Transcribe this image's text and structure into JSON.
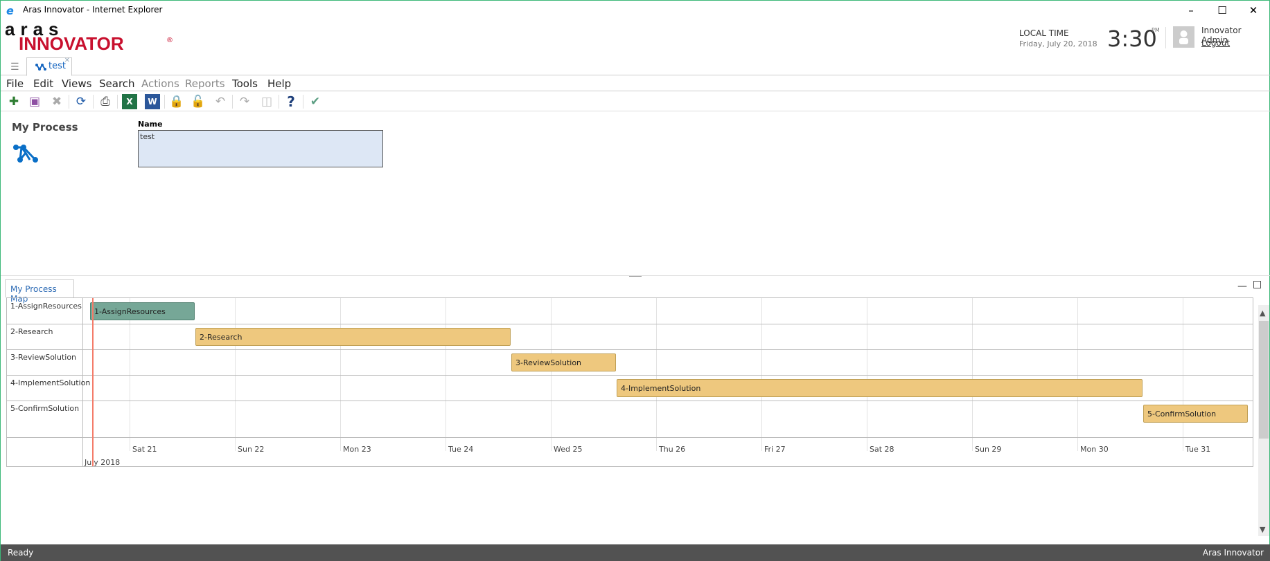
{
  "window": {
    "title": "Aras Innovator - Internet Explorer",
    "icon": "internet-explorer-icon"
  },
  "logo": {
    "line1": "aras",
    "line2": "INNOVATOR",
    "reg": "®"
  },
  "header": {
    "local_time_label": "LOCAL TIME",
    "date": "Friday, July 20, 2018",
    "time": "3:30",
    "ampm": "PM",
    "user": "Innovator Admin",
    "logout": "Logout"
  },
  "tabs": [
    {
      "label": "test",
      "icon": "process-icon"
    }
  ],
  "menu": [
    {
      "label": "File",
      "enabled": true
    },
    {
      "label": "Edit",
      "enabled": true
    },
    {
      "label": "Views",
      "enabled": true
    },
    {
      "label": "Search",
      "enabled": true
    },
    {
      "label": "Actions",
      "enabled": false
    },
    {
      "label": "Reports",
      "enabled": false
    },
    {
      "label": "Tools",
      "enabled": true
    },
    {
      "label": "Help",
      "enabled": true
    }
  ],
  "toolbar": [
    "new-icon",
    "save-icon",
    "discard-icon",
    "refresh-icon",
    "print-icon",
    "excel-icon",
    "word-icon",
    "lock-icon",
    "unlock-icon",
    "undo-icon",
    "promote-icon",
    "paste-icon",
    "help-icon",
    "done-icon"
  ],
  "form": {
    "title": "My Process",
    "name_label": "Name",
    "name_value": "test"
  },
  "panel": {
    "tab": "My Process Map"
  },
  "gantt": {
    "month_label": "July 2018",
    "current_time": "2018-07-20T15:30",
    "days": [
      "Sat 21",
      "Sun 22",
      "Mon 23",
      "Tue 24",
      "Wed 25",
      "Thu 26",
      "Fri 27",
      "Sat 28",
      "Sun 29",
      "Mon 30",
      "Tue 31"
    ],
    "tasks": [
      {
        "name": "1-AssignResources",
        "start": "2018-07-20T15:00",
        "end": "2018-07-21T15:00",
        "color": "#76a797"
      },
      {
        "name": "2-Research",
        "start": "2018-07-21T15:00",
        "end": "2018-07-24T15:00",
        "color": "#eec87e"
      },
      {
        "name": "3-ReviewSolution",
        "start": "2018-07-24T15:00",
        "end": "2018-07-25T15:00",
        "color": "#eec87e"
      },
      {
        "name": "4-ImplementSolution",
        "start": "2018-07-25T15:00",
        "end": "2018-07-30T15:00",
        "color": "#eec87e"
      },
      {
        "name": "5-ConfirmSolution",
        "start": "2018-07-30T15:00",
        "end": "2018-07-31T15:00",
        "color": "#eec87e"
      }
    ]
  },
  "status": {
    "left": "Ready",
    "right": "Aras Innovator"
  }
}
